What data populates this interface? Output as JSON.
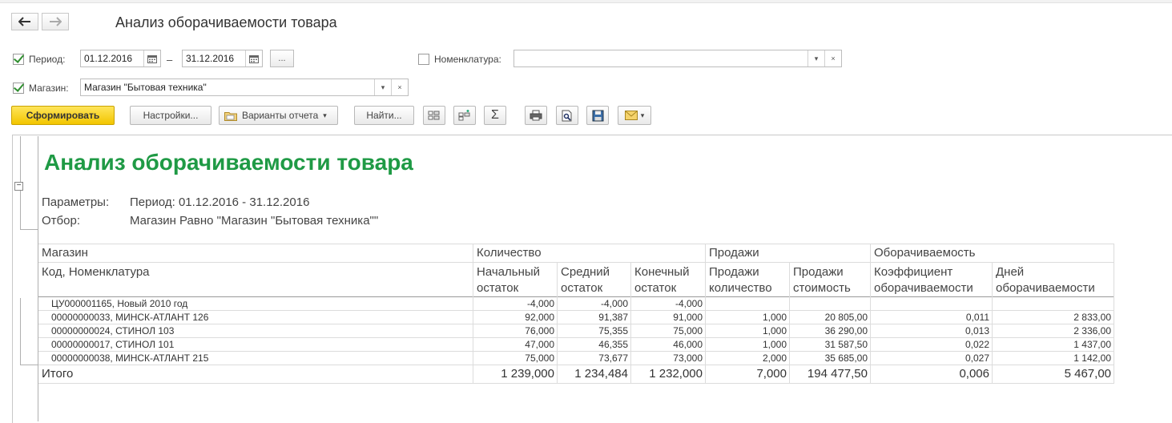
{
  "window": {
    "title": "Анализ оборачиваемости товара",
    "back_icon": "arrow-left-icon",
    "forward_icon": "arrow-right-icon"
  },
  "filters": {
    "period_label": "Период:",
    "period_checked": true,
    "date_from": "01.12.2016",
    "date_dash": "–",
    "date_to": "31.12.2016",
    "more_button": "...",
    "nomenclature_label": "Номенклатура:",
    "nomenclature_checked": false,
    "nomenclature_value": "",
    "shop_label": "Магазин:",
    "shop_checked": true,
    "shop_value": "Магазин \"Бытовая техника\""
  },
  "toolbar": {
    "generate": "Сформировать",
    "settings": "Настройки...",
    "variants": "Варианты отчета",
    "find": "Найти...",
    "icons": [
      "expand-groups-icon",
      "collapse-groups-icon",
      "sum-icon",
      "print-icon",
      "preview-icon",
      "save-icon",
      "email-icon"
    ],
    "sum_glyph": "Σ"
  },
  "report": {
    "title": "Анализ оборачиваемости товара",
    "params_label": "Параметры:",
    "params_value": "Период: 01.12.2016 - 31.12.2016",
    "filter_label": "Отбор:",
    "filter_value": "Магазин Равно \"Магазин \"Бытовая техника\"\"",
    "header": {
      "shop": "Магазин",
      "code_nom": "Код, Номенклатура",
      "quantity": "Количество",
      "sales": "Продажи",
      "turnover": "Оборачиваемость",
      "start_1": "Начальный",
      "start_2": "остаток",
      "avg_1": "Средний",
      "avg_2": "остаток",
      "end_1": "Конечный",
      "end_2": "остаток",
      "sqty_1": "Продажи",
      "sqty_2": "количество",
      "scost_1": "Продажи",
      "scost_2": "стоимость",
      "coef_1": "Коэффициент",
      "coef_2": "оборачиваемости",
      "days_1": "Дней",
      "days_2": "оборачиваемости"
    },
    "rows": [
      {
        "name": "ЦУ000001165, Новый 2010 год",
        "start": "-4,000",
        "avg": "-4,000",
        "end": "-4,000",
        "sqty": "",
        "scost": "",
        "coef": "",
        "days": ""
      },
      {
        "name": "00000000033, МИНСК-АТЛАНТ 126",
        "start": "92,000",
        "avg": "91,387",
        "end": "91,000",
        "sqty": "1,000",
        "scost": "20 805,00",
        "coef": "0,011",
        "days": "2 833,00"
      },
      {
        "name": "00000000024, СТИНОЛ 103",
        "start": "76,000",
        "avg": "75,355",
        "end": "75,000",
        "sqty": "1,000",
        "scost": "36 290,00",
        "coef": "0,013",
        "days": "2 336,00"
      },
      {
        "name": "00000000017, СТИНОЛ 101",
        "start": "47,000",
        "avg": "46,355",
        "end": "46,000",
        "sqty": "1,000",
        "scost": "31 587,50",
        "coef": "0,022",
        "days": "1 437,00"
      },
      {
        "name": "00000000038, МИНСК-АТЛАНТ 215",
        "start": "75,000",
        "avg": "73,677",
        "end": "73,000",
        "sqty": "2,000",
        "scost": "35 685,00",
        "coef": "0,027",
        "days": "1 142,00"
      }
    ],
    "total": {
      "name": "Итого",
      "start": "1 239,000",
      "avg": "1 234,484",
      "end": "1 232,000",
      "sqty": "7,000",
      "scost": "194 477,50",
      "coef": "0,006",
      "days": "5 467,00"
    }
  }
}
